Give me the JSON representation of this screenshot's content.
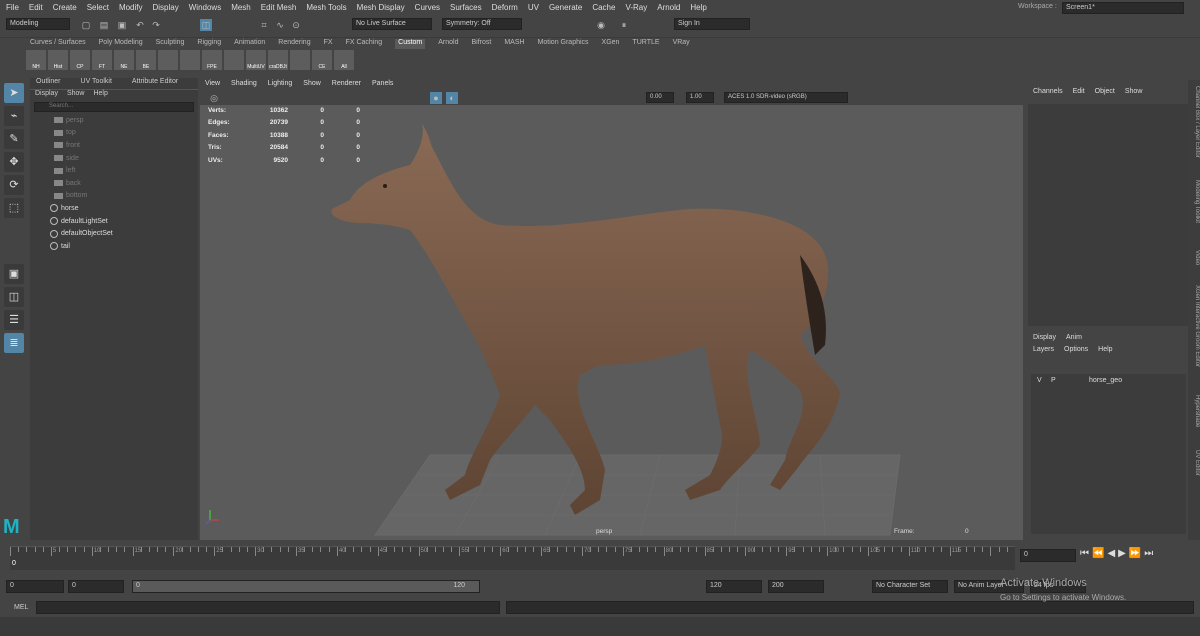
{
  "menu": [
    "File",
    "Edit",
    "Create",
    "Select",
    "Modify",
    "Display",
    "Windows",
    "Mesh",
    "Edit Mesh",
    "Mesh Tools",
    "Mesh Display",
    "Curves",
    "Surfaces",
    "Deform",
    "UV",
    "Generate",
    "Cache",
    "V-Ray",
    "Arnold",
    "Help"
  ],
  "workspace": {
    "label": "Workspace :",
    "value": "Screen1*"
  },
  "status": {
    "mode": "Modeling",
    "live_surface": "No Live Surface",
    "symmetry": "Symmetry: Off",
    "sign_in": "Sign In"
  },
  "shelf_tabs": [
    "Curves / Surfaces",
    "Poly Modeling",
    "Sculpting",
    "Rigging",
    "Animation",
    "Rendering",
    "FX",
    "FX Caching",
    "Custom",
    "Arnold",
    "Bifrost",
    "MASH",
    "Motion Graphics",
    "XGen",
    "TURTLE",
    "VRay"
  ],
  "shelf_icons": [
    {
      "label": "NH"
    },
    {
      "label": "Hist"
    },
    {
      "label": "CP"
    },
    {
      "label": "FT"
    },
    {
      "label": "NE"
    },
    {
      "label": "BE"
    },
    {
      "label": ""
    },
    {
      "label": ""
    },
    {
      "label": "FPE"
    },
    {
      "label": ""
    },
    {
      "label": "MultiUV"
    },
    {
      "label": "craDBJt"
    },
    {
      "label": ""
    },
    {
      "label": "CE"
    },
    {
      "label": "All"
    }
  ],
  "outliner": {
    "tabs": [
      "Outliner",
      "UV Toolkit",
      "Attribute Editor"
    ],
    "menu": [
      "Display",
      "Show",
      "Help"
    ],
    "search_placeholder": "Search...",
    "items": [
      {
        "label": "persp",
        "dim": true
      },
      {
        "label": "top",
        "dim": true
      },
      {
        "label": "front",
        "dim": true
      },
      {
        "label": "side",
        "dim": true
      },
      {
        "label": "left",
        "dim": true
      },
      {
        "label": "back",
        "dim": true
      },
      {
        "label": "bottom",
        "dim": true
      },
      {
        "label": "horse",
        "dim": false
      },
      {
        "label": "defaultLightSet",
        "dim": false
      },
      {
        "label": "defaultObjectSet",
        "dim": false
      },
      {
        "label": "tail",
        "dim": false
      }
    ]
  },
  "viewport": {
    "menu": [
      "View",
      "Shading",
      "Lighting",
      "Show",
      "Renderer",
      "Panels"
    ],
    "field1": "0.00",
    "field2": "1.00",
    "color_mgmt": "ACES 1.0 SDR-video (sRGB)",
    "hud": [
      [
        "Verts:",
        "10362",
        "0",
        "0"
      ],
      [
        "Edges:",
        "20739",
        "0",
        "0"
      ],
      [
        "Faces:",
        "10388",
        "0",
        "0"
      ],
      [
        "Tris:",
        "20584",
        "0",
        "0"
      ],
      [
        "UVs:",
        "9520",
        "0",
        "0"
      ]
    ],
    "camera": "persp",
    "frame_label": "Frame:",
    "frame_value": "0"
  },
  "channel_box": {
    "menu": [
      "Channels",
      "Edit",
      "Object",
      "Show"
    ]
  },
  "layer_editor": {
    "tabs": [
      "Display",
      "Anim"
    ],
    "menu": [
      "Layers",
      "Options",
      "Help"
    ],
    "layer": {
      "v": "V",
      "p": "P",
      "name": "horse_geo"
    }
  },
  "side_tabs": [
    "Channel Box / Layer Editor",
    "Modeling Toolkit",
    "Video",
    "XGen Interactive Groom Editor",
    "Hypershade",
    "UV Editor"
  ],
  "timeline": {
    "ticks": [
      "5",
      "10",
      "15",
      "20",
      "25",
      "30",
      "35",
      "40",
      "45",
      "50",
      "55",
      "60",
      "65",
      "70",
      "75",
      "80",
      "85",
      "90",
      "95",
      "100",
      "105",
      "110",
      "115"
    ],
    "start_label": "0",
    "current": "0"
  },
  "range": {
    "start": "0",
    "anim_start": "0",
    "slider_start": "0",
    "slider_end": "120",
    "end": "120",
    "anim_end": "200",
    "character": "No Character Set",
    "anim_layer": "No Anim Layer",
    "fps": "24 fps"
  },
  "command": {
    "label": "MEL"
  },
  "watermark": {
    "line1": "Activate Windows",
    "line2": "Go to Settings to activate Windows."
  },
  "colors": {
    "accent": "#5285a6",
    "horse": "#7a5a45",
    "viewport": "#5b5b5b"
  }
}
